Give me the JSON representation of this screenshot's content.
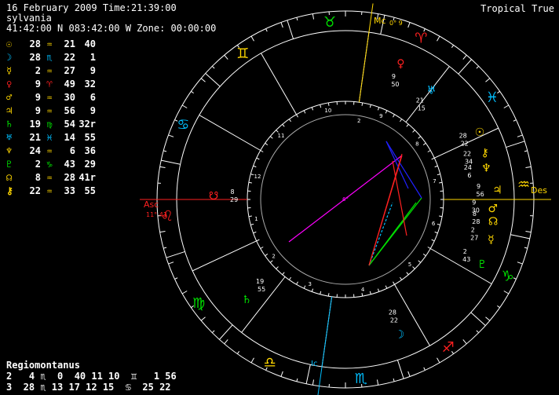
{
  "header": {
    "line1": "16 February 2009 Time:21:39:00",
    "line2": "sylvania",
    "line3": "41:42:00 N 083:42:00 W Zone: 00:00:00",
    "mode": "Tropical True"
  },
  "planets": [
    {
      "glyph": "☉",
      "color": "#ffd700",
      "deg": "28",
      "sign": "♒",
      "sign_color": "#ffd700",
      "min": "21",
      "sec": "40"
    },
    {
      "glyph": "☽",
      "color": "#00bfff",
      "deg": "28",
      "sign": "♏",
      "sign_color": "#00bfff",
      "min": "22",
      "sec": "1"
    },
    {
      "glyph": "☿",
      "color": "#ffd700",
      "deg": "2",
      "sign": "♒",
      "sign_color": "#ffd700",
      "min": "27",
      "sec": "9"
    },
    {
      "glyph": "♀",
      "color": "#ff2020",
      "deg": "9",
      "sign": "♈",
      "sign_color": "#ff2020",
      "min": "49",
      "sec": "32"
    },
    {
      "glyph": "♂",
      "color": "#ffd700",
      "deg": "9",
      "sign": "♒",
      "sign_color": "#ffd700",
      "min": "30",
      "sec": "6"
    },
    {
      "glyph": "♃",
      "color": "#ffd700",
      "deg": "9",
      "sign": "♒",
      "sign_color": "#ffd700",
      "min": "56",
      "sec": "9"
    },
    {
      "glyph": "♄",
      "color": "#00e000",
      "deg": "19",
      "sign": "♍",
      "sign_color": "#00e000",
      "min": "54",
      "sec": "32r"
    },
    {
      "glyph": "♅",
      "color": "#00bfff",
      "deg": "21",
      "sign": "♓",
      "sign_color": "#00bfff",
      "min": "14",
      "sec": "55"
    },
    {
      "glyph": "♆",
      "color": "#ffd700",
      "deg": "24",
      "sign": "♒",
      "sign_color": "#ffd700",
      "min": "6",
      "sec": "36"
    },
    {
      "glyph": "♇",
      "color": "#00e000",
      "deg": "2",
      "sign": "♑",
      "sign_color": "#00e000",
      "min": "43",
      "sec": "29"
    },
    {
      "glyph": "☊",
      "color": "#ffd700",
      "deg": "8",
      "sign": "♒",
      "sign_color": "#ffd700",
      "min": "28",
      "sec": "41r"
    },
    {
      "glyph": "⚷",
      "color": "#ffd700",
      "deg": "22",
      "sign": "♒",
      "sign_color": "#ffd700",
      "min": "33",
      "sec": "55"
    }
  ],
  "houses": {
    "system": "Regiomontanus",
    "row1": "2   4 ♏  0  40 11 10  ♊   1 56",
    "row2": "3  28 ♏ 13 17 12 15  ♋  25 22"
  },
  "angles": {
    "asc_label": "Asc",
    "asc_deg": "11° 41",
    "des_label": "Des",
    "mc_label": "Mc",
    "mc_deg": "0° 9",
    "ic_label": "Ic"
  },
  "wheel_signs": [
    {
      "glyph": "♉",
      "color": "#00e000"
    },
    {
      "glyph": "♈",
      "color": "#ff2020"
    },
    {
      "glyph": "♓",
      "color": "#00bfff"
    },
    {
      "glyph": "♒",
      "color": "#ffd700"
    },
    {
      "glyph": "♑",
      "color": "#00e000"
    },
    {
      "glyph": "♐",
      "color": "#ff2020"
    },
    {
      "glyph": "♏",
      "color": "#00bfff"
    },
    {
      "glyph": "♎",
      "color": "#ffd700"
    },
    {
      "glyph": "♍",
      "color": "#00e000"
    },
    {
      "glyph": "♌",
      "color": "#ff2020"
    },
    {
      "glyph": "♋",
      "color": "#00bfff"
    },
    {
      "glyph": "♊",
      "color": "#ffd700"
    }
  ],
  "house_numbers": [
    "1",
    "2",
    "3",
    "4",
    "5",
    "6",
    "7",
    "8",
    "9",
    "10",
    "11",
    "12"
  ],
  "wheel_planets": [
    {
      "glyph": "♀",
      "color": "#ff2020",
      "deg": "9",
      "min": "50"
    },
    {
      "glyph": "♅",
      "color": "#00bfff",
      "deg": "21",
      "min": "15"
    },
    {
      "glyph": "☉",
      "color": "#ffd700",
      "deg": "28",
      "min": "22"
    },
    {
      "glyph": "⚷",
      "color": "#ffd700",
      "deg": "22",
      "min": "34"
    },
    {
      "glyph": "♆",
      "color": "#ffd700",
      "deg": "24",
      "min": "6"
    },
    {
      "glyph": "♃",
      "color": "#ffd700",
      "deg": "9",
      "min": "56"
    },
    {
      "glyph": "♂",
      "color": "#ffd700",
      "deg": "9",
      "min": "30"
    },
    {
      "glyph": "☊",
      "color": "#ffd700",
      "deg": "8",
      "min": "28"
    },
    {
      "glyph": "☿",
      "color": "#ffd700",
      "deg": "2",
      "min": "27"
    },
    {
      "glyph": "♇",
      "color": "#00e000",
      "deg": "2",
      "min": "43"
    },
    {
      "glyph": "☽",
      "color": "#00bfff",
      "deg": "28",
      "min": "22"
    },
    {
      "glyph": "♄",
      "color": "#00e000",
      "deg": "19",
      "min": "55"
    },
    {
      "glyph": "☋",
      "color": "#ff2020",
      "deg": "8",
      "min": "29"
    }
  ],
  "inner_labels": {
    "ac_mark": "2",
    "mc_mark": "6°"
  }
}
